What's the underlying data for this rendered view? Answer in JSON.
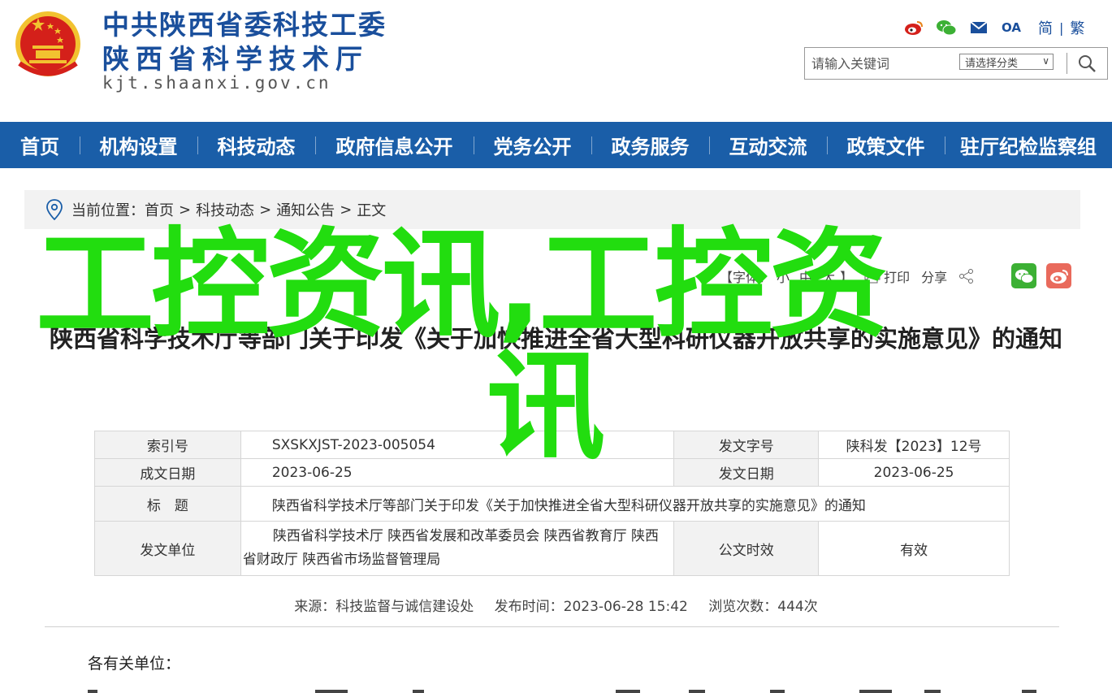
{
  "header": {
    "org_line1": "中共陕西省委科技工委",
    "org_line2": "陕西省科学技术厅",
    "site_url": "kjt.shaanxi.gov.cn",
    "icons": [
      "weibo-icon",
      "wechat-icon",
      "mail-icon",
      "oa-icon"
    ],
    "oa_label": "OA",
    "lang_simplified": "简",
    "lang_separator": "|",
    "lang_traditional": "繁",
    "search_placeholder": "请输入关键词",
    "search_category": "请选择分类"
  },
  "nav": {
    "items": [
      "首页",
      "机构设置",
      "科技动态",
      "政府信息公开",
      "党务公开",
      "政务服务",
      "互动交流",
      "政策文件",
      "驻厅纪检监察组"
    ]
  },
  "breadcrumb": {
    "prefix": "当前位置：",
    "items": [
      "首页",
      "科技动态",
      "通知公告",
      "正文"
    ],
    "separator": ">"
  },
  "tools": {
    "font_label": "【字体：",
    "small": "小",
    "medium": "中",
    "large": "大",
    "font_close": "】",
    "print": "打印",
    "share": "分享"
  },
  "article": {
    "title": "陕西省科学技术厅等部门关于印发《关于加快推进全省大型科研仪器开放共享的实施意见》的通知",
    "greeting": "各有关单位："
  },
  "watermark": {
    "line1": "工控资讯,工控资",
    "line2": "讯"
  },
  "meta": {
    "index_label": "索引号",
    "index_value": "SXSKXJST-2023-005054",
    "docno_label": "发文字号",
    "docno_value": "陕科发【2023】12号",
    "written_label": "成文日期",
    "written_value": "2023-06-25",
    "issued_label": "发文日期",
    "issued_value": "2023-06-25",
    "subject_label": "标　题",
    "subject_value": "陕西省科学技术厅等部门关于印发《关于加快推进全省大型科研仪器开放共享的实施意见》的通知",
    "issuer_label": "发文单位",
    "issuer_value": "陕西省科学技术厅 陕西省发展和改革委员会 陕西省教育厅 陕西省财政厅 陕西省市场监督管理局",
    "validity_label": "公文时效",
    "validity_value": "有效"
  },
  "source": {
    "from": "来源：科技监督与诚信建设处",
    "published": "发布时间：2023-06-28 15:42",
    "views": "浏览次数：444次"
  },
  "colors": {
    "nav_bg": "#1a5ea8",
    "brand_blue": "#1a4f9c",
    "watermark_green": "#22dd0f",
    "emblem_red": "#d4201a",
    "emblem_gold": "#f2c230",
    "wechat_green": "#3cb034",
    "weibo_red": "#e96a5c"
  }
}
